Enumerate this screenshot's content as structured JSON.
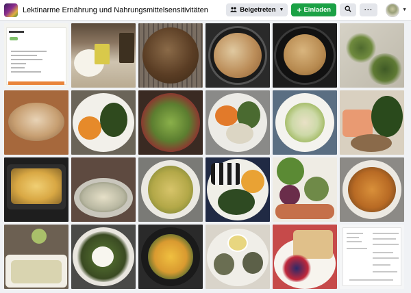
{
  "header": {
    "group_title": "Lektinarme Ernährung und Nahrungsmittelsensitivitäten",
    "joined_label": "Beigetreten",
    "invite_label": "Einladen",
    "more_label": "···"
  },
  "icons": {
    "joined": "people-icon",
    "invite": "plus-icon",
    "search": "search-icon",
    "profile_caret": "chevron-down-icon"
  },
  "colors": {
    "invite_button": "#1ba145",
    "header_bg": "#ffffff",
    "page_bg": "#f0f2f5"
  },
  "photos": [
    {
      "name": "recipe-note"
    },
    {
      "name": "flour-bowl-and-packages"
    },
    {
      "name": "bread-loaf-cooling-rack"
    },
    {
      "name": "bread-in-dutch-oven"
    },
    {
      "name": "bread-in-pot"
    },
    {
      "name": "herbs-on-table"
    },
    {
      "name": "baked-loaf-on-paper"
    },
    {
      "name": "carrots-and-greens-plate"
    },
    {
      "name": "mixed-salad-bowl"
    },
    {
      "name": "vegetable-plate"
    },
    {
      "name": "pasta-salad-plate"
    },
    {
      "name": "salmon-and-spinach"
    },
    {
      "name": "baked-dish-tray"
    },
    {
      "name": "gratin-in-dish"
    },
    {
      "name": "potatoes-plate"
    },
    {
      "name": "sushi-and-greens-plate"
    },
    {
      "name": "vegetables-assortment"
    },
    {
      "name": "roasted-potatoes-plate"
    },
    {
      "name": "casserole-dish"
    },
    {
      "name": "rice-with-vegetables"
    },
    {
      "name": "pan-roasted-vegetables"
    },
    {
      "name": "artichokes-with-dip"
    },
    {
      "name": "cake-with-berries"
    },
    {
      "name": "document-screenshot"
    }
  ]
}
